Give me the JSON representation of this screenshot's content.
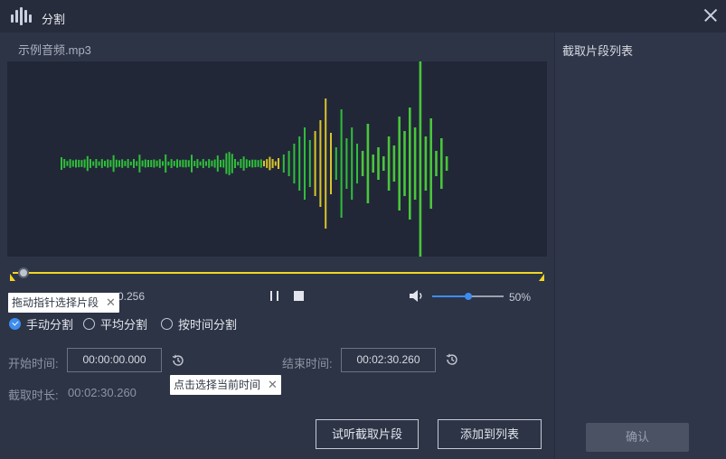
{
  "window": {
    "title": "分割",
    "close_icon": "close-icon",
    "logo_icon": "audio-bars-icon"
  },
  "file": {
    "name": "示例音频.mp3"
  },
  "timeline": {
    "tooltip": "拖动指针选择片段",
    "time_readout": "0.256",
    "playhead_fraction": 0.0
  },
  "player": {
    "pause_icon": "pause-icon",
    "stop_icon": "stop-icon",
    "volume_icon": "volume-icon",
    "volume_percent_text": "50%",
    "volume_fraction": 0.5
  },
  "modes": [
    {
      "label": "手动分割",
      "checked": true
    },
    {
      "label": "平均分割",
      "checked": false
    },
    {
      "label": "按时间分割",
      "checked": false
    }
  ],
  "start": {
    "label": "开始时间:",
    "value": "00:00:00.000"
  },
  "end": {
    "label": "结束时间:",
    "value": "00:02:30.260"
  },
  "clock_tooltip": "点击选择当前时间",
  "duration": {
    "label": "截取时长:",
    "value": "00:02:30.260"
  },
  "buttons": {
    "preview": "试听截取片段",
    "add": "添加到列表",
    "confirm": "确认"
  },
  "sidebar": {
    "title": "截取片段列表"
  },
  "colors": {
    "accent": "#3d8df0",
    "timeline": "#f2d523",
    "wave_green": "#2fbf3a",
    "wave_yellow": "#d9c42a"
  }
}
